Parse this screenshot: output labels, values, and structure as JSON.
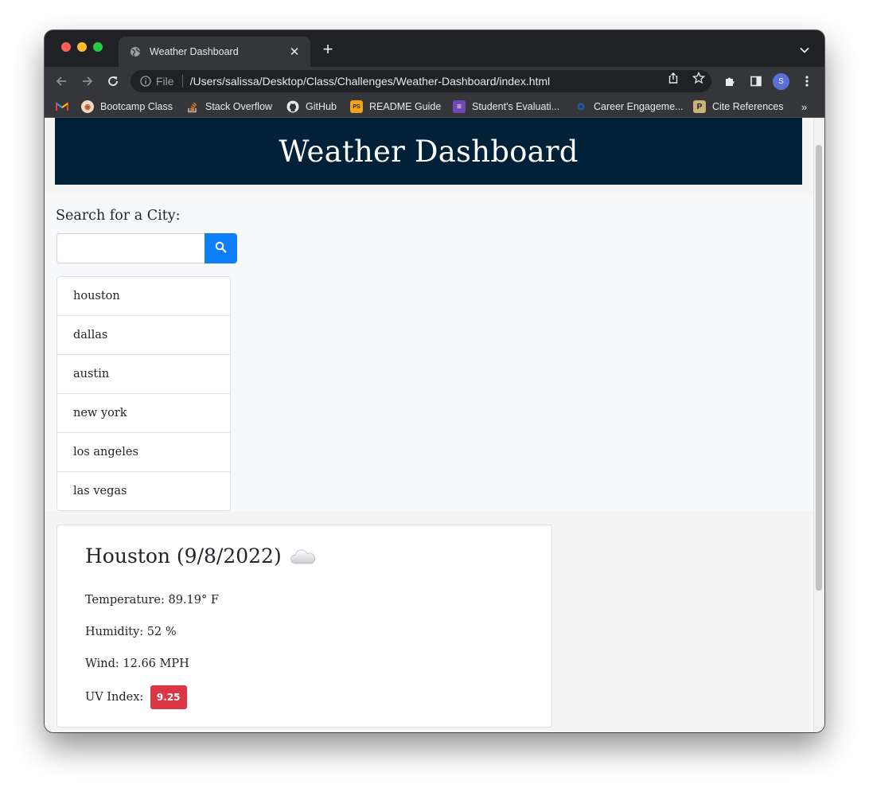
{
  "browser": {
    "tab_title": "Weather Dashboard",
    "url_scheme": "File",
    "url": "/Users/salissa/Desktop/Class/Challenges/Weather-Dashboard/index.html",
    "profile_initial": "S",
    "bookmarks": [
      {
        "label": "Bootcamp Class",
        "icon": "bootcamp-icon"
      },
      {
        "label": "Stack Overflow",
        "icon": "stackoverflow-icon"
      },
      {
        "label": "GitHub",
        "icon": "github-icon"
      },
      {
        "label": "README Guide",
        "icon": "readme-icon"
      },
      {
        "label": "Student's Evaluati...",
        "icon": "forms-icon"
      },
      {
        "label": "Career Engageme...",
        "icon": "career-icon"
      },
      {
        "label": "Cite References",
        "icon": "cite-icon"
      }
    ],
    "bookmarks_more": "»"
  },
  "page": {
    "header_title": "Weather Dashboard",
    "search_label": "Search for a City:",
    "search_value": "",
    "cities": [
      "houston",
      "dallas",
      "austin",
      "new york",
      "los angeles",
      "las vegas"
    ],
    "current": {
      "title": "Houston (9/8/2022)",
      "icon": "cloud-icon",
      "temperature": "Temperature: 89.19° F",
      "humidity": "Humidity: 52 %",
      "wind": "Wind: 12.66 MPH",
      "uv_label": "UV Index:",
      "uv_value": "9.25"
    }
  },
  "colors": {
    "header_bg": "#002138",
    "search_button": "#0d7ffb",
    "uv_badge": "#dc3545"
  }
}
